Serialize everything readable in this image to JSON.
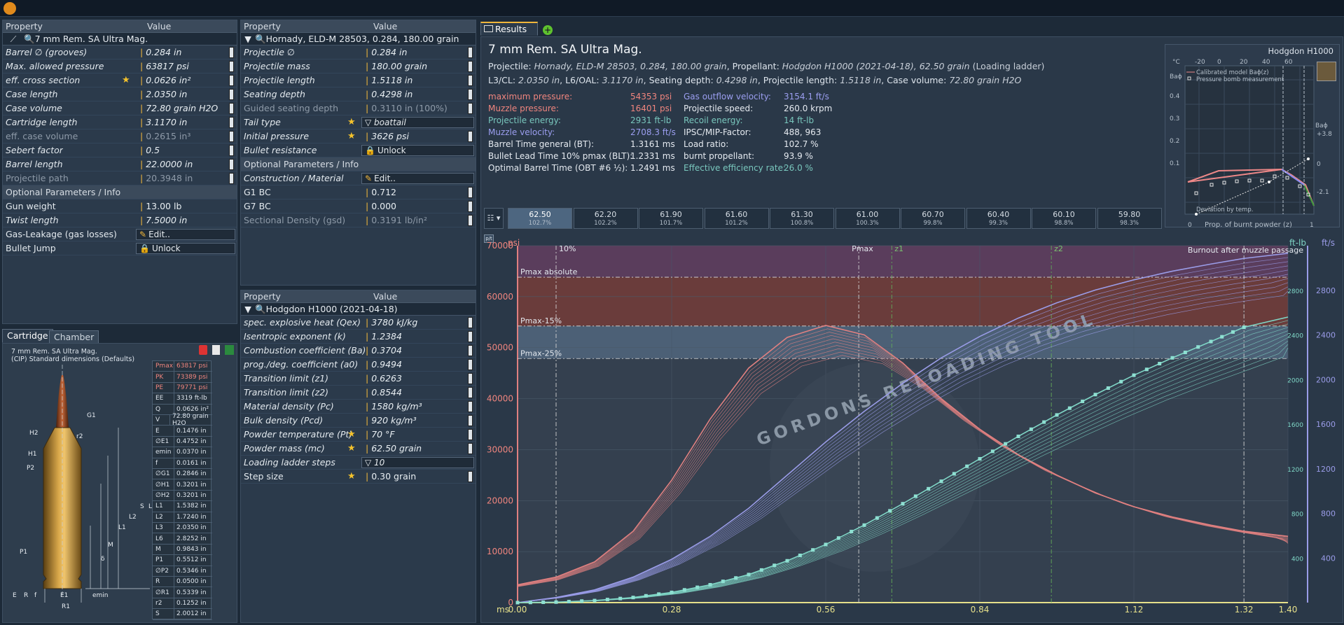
{
  "topbar": {
    "icon": "hat-icon"
  },
  "cartridge_panel": {
    "headers": [
      "Property",
      "Value"
    ],
    "selected": "7 mm Rem. SA Ultra Mag.",
    "rows": [
      {
        "name": "Barrel ∅ (grooves)",
        "value": "0.284 in",
        "style": "it"
      },
      {
        "name": "Max. allowed pressure",
        "value": "63817 psi",
        "style": "it"
      },
      {
        "name": "eff. cross section",
        "value": "0.0626 in²",
        "style": "it",
        "star": true
      },
      {
        "name": "Case length",
        "value": "2.0350 in",
        "style": "it"
      },
      {
        "name": "Case volume",
        "value": "72.80 grain H2O",
        "style": "it"
      },
      {
        "name": "Cartridge length",
        "value": "3.1170 in",
        "style": "it"
      },
      {
        "name": "eff. case volume",
        "value": "0.2615 in³",
        "style": "dim"
      },
      {
        "name": "Sebert factor",
        "value": "0.5",
        "style": "it"
      },
      {
        "name": "Barrel length",
        "value": "22.0000 in",
        "style": "it"
      },
      {
        "name": "Projectile path",
        "value": "20.3948 in",
        "style": "dim"
      }
    ],
    "section": "Optional Parameters / Info",
    "opt_rows": [
      {
        "name": "Gun weight",
        "value": "13.00 lb"
      },
      {
        "name": "Twist length",
        "value": "7.5000 in",
        "style": "it"
      },
      {
        "name": "Gas-Leakage (gas losses)",
        "button": "Edit.."
      },
      {
        "name": "Bullet Jump",
        "button": "Unlock"
      }
    ]
  },
  "bottom_tabs": [
    "Cartridge",
    "Chamber"
  ],
  "drawing": {
    "title": "7 mm Rem. SA Ultra Mag.",
    "subtitle": "(CIP) Standard dimensions (Defaults)",
    "labels": [
      "G1",
      "H2",
      "r2",
      "H1",
      "P2",
      "S",
      "L3",
      "L2",
      "L1",
      "M",
      "δ",
      "P1",
      "E",
      "R",
      "f",
      "E1",
      "R1",
      "emin"
    ],
    "table": [
      [
        "Pmax",
        "63817 psi"
      ],
      [
        "PK",
        "73389 psi"
      ],
      [
        "PE",
        "79771 psi"
      ],
      [
        "EE",
        "3319 ft-lb"
      ],
      [
        "Q",
        "0.0626 in²"
      ],
      [
        "V",
        "72.80 grain H2O"
      ],
      [
        "E",
        "0.1476 in"
      ],
      [
        "∅E1",
        "0.4752 in"
      ],
      [
        "emin",
        "0.0370 in"
      ],
      [
        "f",
        "0.0161 in"
      ],
      [
        "∅G1",
        "0.2846 in"
      ],
      [
        "∅H1",
        "0.3201 in"
      ],
      [
        "∅H2",
        "0.3201 in"
      ],
      [
        "L1",
        "1.5382 in"
      ],
      [
        "L2",
        "1.7240 in"
      ],
      [
        "L3",
        "2.0350 in"
      ],
      [
        "L6",
        "2.8252 in"
      ],
      [
        "M",
        "0.9843 in"
      ],
      [
        "P1",
        "0.5512 in"
      ],
      [
        "∅P2",
        "0.5346 in"
      ],
      [
        "R",
        "0.0500 in"
      ],
      [
        "∅R1",
        "0.5339 in"
      ],
      [
        "r2",
        "0.1252 in"
      ],
      [
        "S",
        "2.0012 in"
      ]
    ]
  },
  "projectile_panel": {
    "headers": [
      "Property",
      "Value"
    ],
    "selected": "Hornady, ELD-M 28503, 0.284, 180.00 grain",
    "rows": [
      {
        "name": "Projectile ∅",
        "value": "0.284 in",
        "style": "it"
      },
      {
        "name": "Projectile mass",
        "value": "180.00 grain",
        "style": "it"
      },
      {
        "name": "Projectile length",
        "value": "1.5118 in",
        "style": "it"
      },
      {
        "name": "Seating depth",
        "value": "0.4298 in",
        "style": "it"
      },
      {
        "name": "Guided seating depth",
        "value": "0.3110 in (100%)",
        "style": "dim"
      },
      {
        "name": "Tail type",
        "value": "boattail",
        "style": "it",
        "star": true,
        "dropdown": true
      },
      {
        "name": "Initial pressure",
        "value": "3626 psi",
        "style": "it",
        "star": true
      },
      {
        "name": "Bullet resistance",
        "button": "Unlock",
        "style": "it"
      }
    ],
    "section": "Optional Parameters / Info",
    "opt_rows": [
      {
        "name": "Construction / Material",
        "button": "Edit..",
        "style": "it"
      },
      {
        "name": "G1 BC",
        "value": "0.712"
      },
      {
        "name": "G7 BC",
        "value": "0.000"
      },
      {
        "name": "Sectional Density (gsd)",
        "value": "0.3191 lb/in²",
        "style": "dim"
      }
    ]
  },
  "propellant_panel": {
    "headers": [
      "Property",
      "Value"
    ],
    "selected": "Hodgdon H1000 (2021-04-18)",
    "rows": [
      {
        "name": "spec. explosive heat (Qex)",
        "value": "3780 kJ/kg",
        "style": "it"
      },
      {
        "name": "Isentropic exponent (k)",
        "value": "1.2384",
        "style": "it"
      },
      {
        "name": "Combustion coefficient (Ba)",
        "value": "0.3704",
        "style": "it"
      },
      {
        "name": "prog./deg. coefficient (a0)",
        "value": "0.9494",
        "style": "it"
      },
      {
        "name": "Transition limit (z1)",
        "value": "0.6263",
        "style": "it"
      },
      {
        "name": "Transition limit (z2)",
        "value": "0.8544",
        "style": "it"
      },
      {
        "name": "Material density (Pc)",
        "value": "1580 kg/m³",
        "style": "it"
      },
      {
        "name": "Bulk density (Pcd)",
        "value": "920 kg/m³",
        "style": "it"
      },
      {
        "name": "Powder temperature (Pt)",
        "value": "70 °F",
        "style": "it",
        "star": true
      },
      {
        "name": "Powder mass (mc)",
        "value": "62.50 grain",
        "style": "it",
        "star": true
      },
      {
        "name": "Loading ladder steps",
        "value": "10",
        "style": "it",
        "dropdown": true
      },
      {
        "name": "Step size",
        "value": "0.30 grain",
        "star": true
      }
    ]
  },
  "results": {
    "tab": "Results",
    "title": "7 mm Rem. SA Ultra Mag.",
    "line1": {
      "k1": "Projectile:",
      "v1": "Hornady, ELD-M 28503, 0.284, 180.00 grain",
      "k2": ", Propellant:",
      "v2": "Hodgdon H1000 (2021-04-18), 62.50 grain",
      "k3": "(Loading ladder)"
    },
    "line2": [
      [
        "L3/CL:",
        "2.0350 in"
      ],
      [
        "L6/OAL:",
        "3.1170 in"
      ],
      [
        "Seating depth:",
        "0.4298 in"
      ],
      [
        "Projectile length:",
        "1.5118 in"
      ],
      [
        "Case volume:",
        "72.80 grain H2O"
      ]
    ],
    "col1": [
      {
        "k": "maximum pressure:",
        "v": "54353 psi",
        "c": "#f0857e"
      },
      {
        "k": "Muzzle pressure:",
        "v": "16401 psi",
        "c": "#f0857e"
      },
      {
        "k": "Projectile energy:",
        "v": "2931 ft-lb",
        "c": "#79c7bd"
      },
      {
        "k": "Muzzle velocity:",
        "v": "2708.3 ft/s",
        "c": "#9b9ef0"
      },
      {
        "k": "Barrel Time general (BT):",
        "v": "1.3161 ms",
        "c": "#e5eaf0"
      },
      {
        "k": "Bullet Lead Time 10% pmax (BLT):",
        "v": "1.2331 ms",
        "c": "#e5eaf0"
      },
      {
        "k": "Optimal Barrel Time (OBT #6 ½):",
        "v": "1.2491 ms",
        "c": "#e5eaf0"
      }
    ],
    "col2": [
      {
        "k": "Gas outflow velocity:",
        "v": "3154.1 ft/s",
        "c": "#9b9ef0"
      },
      {
        "k": "Projectile speed:",
        "v": "260.0 krpm",
        "c": "#e5eaf0"
      },
      {
        "k": "Recoil energy:",
        "v": "14 ft-lb",
        "c": "#79c7bd"
      },
      {
        "k": "IPSC/MIP-Factor:",
        "v": "488, 963",
        "c": "#e5eaf0"
      },
      {
        "k": "Load ratio:",
        "v": "102.7 %",
        "c": "#e5eaf0"
      },
      {
        "k": "burnt propellant:",
        "v": "93.9 %",
        "c": "#e5eaf0"
      },
      {
        "k": "Effective efficiency rate:",
        "v": "26.0 %",
        "c": "#79c7bd"
      }
    ]
  },
  "ladder": [
    [
      "62.50",
      "102.7%"
    ],
    [
      "62.20",
      "102.2%"
    ],
    [
      "61.90",
      "101.7%"
    ],
    [
      "61.60",
      "101.2%"
    ],
    [
      "61.30",
      "100.8%"
    ],
    [
      "61.00",
      "100.3%"
    ],
    [
      "60.70",
      "99.8%"
    ],
    [
      "60.40",
      "99.3%"
    ],
    [
      "60.10",
      "98.8%"
    ],
    [
      "59.80",
      "98.3%"
    ]
  ],
  "inset": {
    "title": "Hodgdon H1000",
    "xlabel": "Prop. of burnt powder (z)",
    "ylabel_left": "Baɸ",
    "ylabel_right": "Baɸ",
    "top_axis": [
      "°C",
      "-20",
      "0",
      "20",
      "40",
      "60"
    ],
    "legend": [
      "Calibrated model Baɸ(z)",
      "Pressure bomb measurement"
    ],
    "legend2": "Deviation by temp.",
    "yticks": [
      "0.4",
      "0.3",
      "0.2",
      "0.1"
    ],
    "right_ticks": [
      "+3.8",
      "0",
      "-2.1"
    ],
    "xticks": [
      "0",
      "1"
    ]
  },
  "chart_data": {
    "type": "line",
    "x": [
      0.0,
      0.07,
      0.14,
      0.21,
      0.28,
      0.35,
      0.42,
      0.49,
      0.56,
      0.63,
      0.7,
      0.77,
      0.84,
      0.91,
      0.98,
      1.05,
      1.12,
      1.19,
      1.26,
      1.32,
      1.4
    ],
    "xticks": [
      "0.00",
      "0.28",
      "0.56",
      "0.84",
      "1.12",
      "1.32",
      "1.40"
    ],
    "xlabel": "ms",
    "xlim": [
      0,
      1.4
    ],
    "ylabel_left": "psi",
    "ylabel_right1": "ft-lb",
    "ylabel_right2": "ft/s",
    "ylim": [
      0,
      70000
    ],
    "yticks": [
      "0",
      "10000",
      "20000",
      "30000",
      "40000",
      "50000",
      "60000",
      "70000"
    ],
    "y2ticks": [
      "400",
      "800",
      "1200",
      "1600",
      "2000",
      "2400",
      "2800"
    ],
    "y3ticks": [
      "400",
      "800",
      "1200",
      "1600",
      "2000",
      "2400",
      "2800"
    ],
    "series": [
      {
        "name": "",
        "values": [
          3500,
          5000,
          8000,
          14000,
          24000,
          36000,
          46000,
          52000,
          54353,
          52500,
          47000,
          40000,
          34000,
          29000,
          25000,
          21500,
          18800,
          16800,
          15200,
          14000,
          13000
        ],
        "color": "#e08080"
      },
      {
        "name": "",
        "values": [
          0,
          1000,
          2500,
          5000,
          8500,
          13000,
          18500,
          25000,
          31500,
          37500,
          43000,
          48000,
          52200,
          55800,
          58800,
          61300,
          63300,
          65000,
          66400,
          67500,
          68500
        ],
        "color": "#9a9ce8"
      },
      {
        "name": "",
        "values": [
          0,
          100,
          400,
          1000,
          2000,
          3500,
          5500,
          8200,
          11400,
          15200,
          19400,
          23800,
          28200,
          32600,
          36800,
          40800,
          44600,
          48000,
          51200,
          54000,
          56000
        ],
        "color": "#7fd6c6"
      }
    ],
    "hlines": [
      {
        "label": "Pmax absolute",
        "y": 63817
      },
      {
        "label": "Pmax-15%",
        "y": 54244
      },
      {
        "label": "Pmax-25%",
        "y": 47863
      }
    ],
    "vlines": [
      {
        "label": "10%",
        "x": 0.07
      },
      {
        "label": "Pmax",
        "x": 0.62
      },
      {
        "label": "z1",
        "x": 0.68
      },
      {
        "label": "z2",
        "x": 0.97
      },
      {
        "label": "",
        "x": 1.32
      }
    ],
    "annotation": "Burnout after muzzle passage",
    "watermark": "GORDONS RELOADING TOOL",
    "legend": "none",
    "grid": true
  }
}
